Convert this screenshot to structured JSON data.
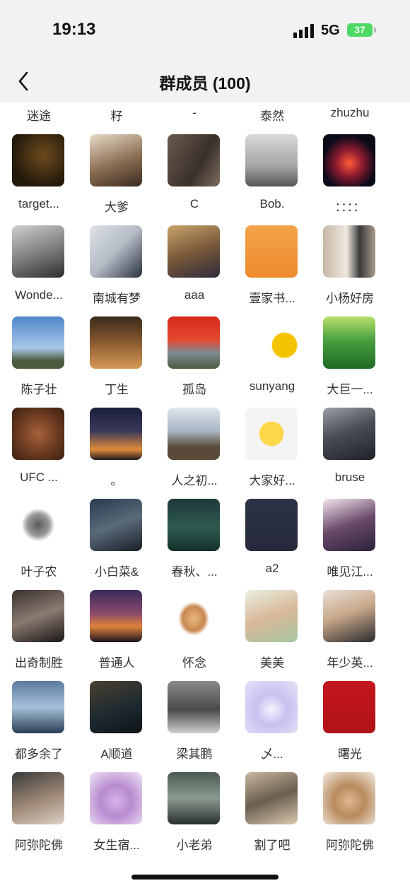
{
  "status_bar": {
    "time": "19:13",
    "network": "5G",
    "battery": "37",
    "icons": [
      "signal-icon",
      "battery-charging-icon"
    ]
  },
  "nav": {
    "title": "群成员 (100)",
    "back_icon": "chevron-left-icon"
  },
  "members": [
    {
      "name": "迷途",
      "bg": "linear-gradient(135deg,#ddd,#888 50%,#333)"
    },
    {
      "name": "籽",
      "bg": "linear-gradient(160deg,#eee,#999 45%,#222)"
    },
    {
      "name": "-",
      "bg": "linear-gradient(135deg,#f4f4f4,#c9d2e8 55%,#7a8fb8)"
    },
    {
      "name": "泰然",
      "bg": "linear-gradient(135deg,#f6b64d,#e8962a 60%,#6d84b4)"
    },
    {
      "name": "zhuzhu",
      "bg": "radial-gradient(circle at 50% 45%,#444,#111 70%)"
    },
    {
      "name": "target...",
      "bg": "radial-gradient(circle at 60% 40%,#6e4a1c,#241a0c 70%)"
    },
    {
      "name": "大爹",
      "bg": "linear-gradient(160deg,#e8dcc8,#8a6d52 55%,#3a2a20)"
    },
    {
      "name": "C",
      "bg": "linear-gradient(120deg,#6a5a4e,#3a302a 60%,#7d6d60)"
    },
    {
      "name": "Bob.",
      "bg": "linear-gradient(180deg,#d9d9d9,#a6a6a6 60%,#555)"
    },
    {
      "name": "：：：：",
      "bg": "radial-gradient(circle at 50% 55%,#ff5a36,#8a1a30 35%,#0a0a18 70%)"
    },
    {
      "name": "Wonde...",
      "bg": "linear-gradient(160deg,#cfcfcf,#7a7a7a 55%,#2e2e2e)"
    },
    {
      "name": "南城有梦",
      "bg": "linear-gradient(135deg,#dfe3e8,#b3bac4 50%,#2b3240)"
    },
    {
      "name": "aaa",
      "bg": "linear-gradient(160deg,#c9a46a,#7a5a3a 50%,#2e2a3a)"
    },
    {
      "name": "壹家书...",
      "bg": "linear-gradient(180deg,#f3a34a,#ee8a2c)"
    },
    {
      "name": "小杨好房",
      "bg": "linear-gradient(90deg,#c7b7a6,#efe8df 45%,#3a3a3a 70%,#a89a8c)"
    },
    {
      "name": "陈子壮",
      "bg": "linear-gradient(180deg,#4f86c8,#a9c8ea 60%,#4b5a3c 85%)"
    },
    {
      "name": "丁生",
      "bg": "linear-gradient(180deg,#3a2a1c,#8a5a30 50%,#d59a55)"
    },
    {
      "name": "孤岛",
      "bg": "linear-gradient(180deg,#d6281c,#e44a30 45%,#7d8a92 70%,#4a5a40)"
    },
    {
      "name": "sunyang",
      "bg": "radial-gradient(circle at 75% 55%,#f5c400,#f5c400 25%,#ffffff 27%)"
    },
    {
      "name": "大巨一...",
      "bg": "linear-gradient(180deg,#b8e06a,#4aa040 45%,#1d6a24)"
    },
    {
      "name": "UFC ...",
      "bg": "radial-gradient(circle at 50% 50%,#a8623a,#6a3a20 55%,#3a200f)"
    },
    {
      "name": "。",
      "bg": "linear-gradient(180deg,#1a1f3a,#3a3a5a 45%,#e08a3a 80%,#201a20)"
    },
    {
      "name": "人之初...",
      "bg": "linear-gradient(180deg,#dfe6ee,#a9b6c4 45%,#5a4a3a 75%)"
    },
    {
      "name": "大家好...",
      "bg": "radial-gradient(circle at 50% 50%,#ffd84a,#ffd84a 32%,#f4f4f4 34%)"
    },
    {
      "name": "bruse",
      "bg": "linear-gradient(160deg,#9aa0a6,#4a4e55 45%,#1e2228)"
    },
    {
      "name": "叶子农",
      "bg": "radial-gradient(ellipse at 50% 50%,#5a5a5a,#9a9a9a 30%,#ffffff 45%)"
    },
    {
      "name": "小白菜&",
      "bg": "linear-gradient(160deg,#2a3a4e,#5a6a7a 50%,#1a1f28)"
    },
    {
      "name": "春秋、...",
      "bg": "linear-gradient(180deg,#1e3a3a,#2e5a50 55%,#14302a)"
    },
    {
      "name": "a2",
      "bg": "linear-gradient(180deg,#2e3246,#262a3c)"
    },
    {
      "name": "唯见江...",
      "bg": "linear-gradient(160deg,#f4e6ee,#6a4a6a 50%,#2a2238)"
    },
    {
      "name": "出奇制胜",
      "bg": "linear-gradient(160deg,#3a302e,#8a7a70 50%,#1a1616)"
    },
    {
      "name": "普通人",
      "bg": "linear-gradient(180deg,#3a2a5a,#8a4a6a 45%,#e0823a 70%,#1a1420)"
    },
    {
      "name": "怀念",
      "bg": "radial-gradient(ellipse at 50% 55%,#e8b880,#c88850 30%,#ffffff 42%)"
    },
    {
      "name": "美美",
      "bg": "linear-gradient(160deg,#e8f0e0,#d9b89a 50%,#a7c7a0)"
    },
    {
      "name": "年少英...",
      "bg": "linear-gradient(160deg,#e8e0d8,#c9a88a 45%,#2a2a2e)"
    },
    {
      "name": "都多余了",
      "bg": "linear-gradient(180deg,#5a7aa0,#a6c0d8 50%,#2c3e58)"
    },
    {
      "name": "A顺道",
      "bg": "linear-gradient(160deg,#4a4030,#1e2a30 55%,#0e1418)"
    },
    {
      "name": "梁其鹏",
      "bg": "linear-gradient(180deg,#8a8a8a,#4a4a4a 55%,#cfcfcf)"
    },
    {
      "name": "乄...",
      "bg": "radial-gradient(circle at 50% 55%,#f4f4ff,#c9c0f0 40%,#e7e2f8)"
    },
    {
      "name": "曙光",
      "bg": "linear-gradient(180deg,#c4161c,#b01218)"
    },
    {
      "name": "阿弥陀佛",
      "bg": "linear-gradient(160deg,#3a3a3a,#a08a78 55%,#dcd0c6)"
    },
    {
      "name": "女生宿...",
      "bg": "radial-gradient(circle at 50% 55%,#d6b4e8,#b88ad0 40%,#f0e6f6)"
    },
    {
      "name": "小老弟",
      "bg": "linear-gradient(180deg,#4a5a50,#8a9a90 50%,#2a302c)"
    },
    {
      "name": "割了吧",
      "bg": "linear-gradient(160deg,#c8b8a0,#6a5e4e 50%,#d8c8b0)"
    },
    {
      "name": "阿弥陀佛",
      "bg": "radial-gradient(circle at 50% 55%,#e0b890,#b88a5e 40%,#f4ede4)"
    }
  ]
}
